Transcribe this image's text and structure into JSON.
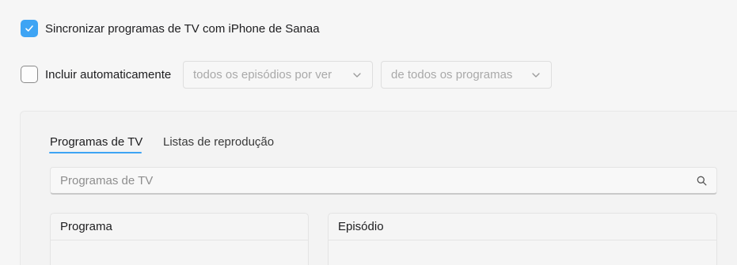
{
  "sync": {
    "checked": true,
    "label": "Sincronizar programas de TV com iPhone de Sanaa"
  },
  "auto_include": {
    "checked": false,
    "label": "Incluir automaticamente",
    "episodes_select": "todos os episódios por ver",
    "programs_select": "de todos os programas"
  },
  "tabs": [
    {
      "label": "Programas de TV",
      "active": true
    },
    {
      "label": "Listas de reprodução",
      "active": false
    }
  ],
  "search": {
    "placeholder": "Programas de TV"
  },
  "columns": {
    "program_header": "Programa",
    "episode_header": "Episódio"
  },
  "colors": {
    "accent": "#3ea4f4",
    "background": "#f6f6f6"
  },
  "icons": {
    "checkmark": "checkmark-icon",
    "chevron": "chevron-down-icon",
    "search": "search-icon"
  }
}
